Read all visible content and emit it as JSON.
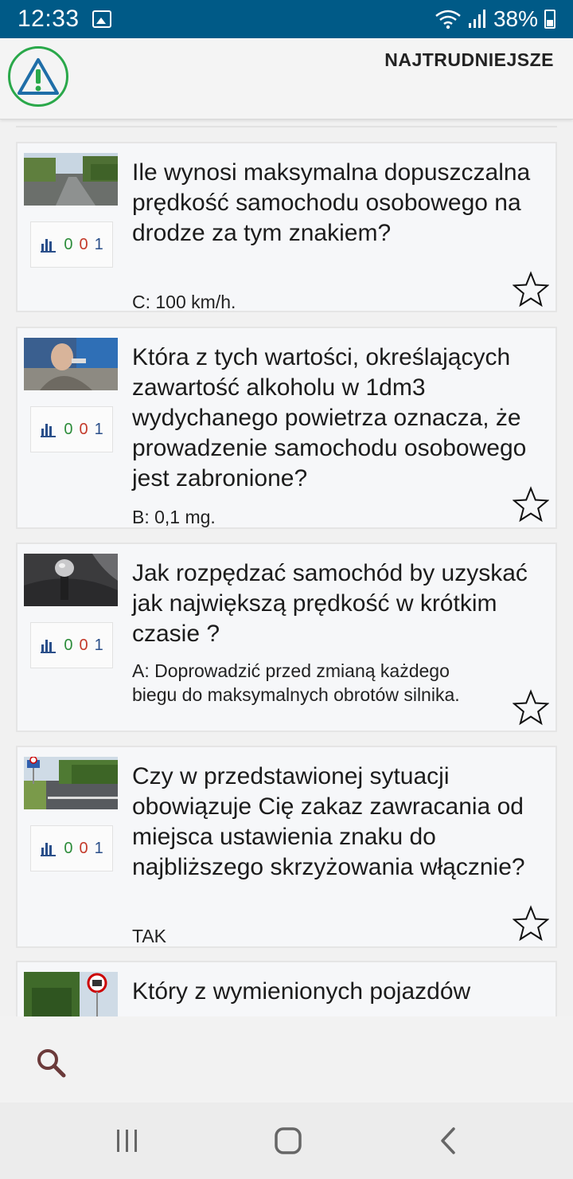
{
  "status": {
    "time": "12:33",
    "battery": "38%"
  },
  "appbar": {
    "title": "NAJTRUDNIEJSZE"
  },
  "questions": [
    {
      "text": "Ile wynosi maksymalna dopuszczalna prędkość samochodu osobowego na drodze za tym znakiem?",
      "answer": "C: 100 km/h.",
      "stats": {
        "correct": "0",
        "wrong": "0",
        "total": "1"
      }
    },
    {
      "text": "Która z tych wartości, określających zawartość alkoholu w 1dm3 wydychanego powietrza oznacza, że prowadzenie samochodu osobowego jest zabronione?",
      "answer": "B: 0,1 mg.",
      "stats": {
        "correct": "0",
        "wrong": "0",
        "total": "1"
      }
    },
    {
      "text": "Jak rozpędzać samochód by uzyskać jak największą prędkość w krótkim czasie ?",
      "answer": "A: Doprowadzić przed zmianą każdego biegu do maksymalnych obrotów silnika.",
      "stats": {
        "correct": "0",
        "wrong": "0",
        "total": "1"
      }
    },
    {
      "text": "Czy w przedstawionej sytuacji obowiązuje Cię zakaz zawracania od miejsca ustawienia znaku do najbliższego skrzyżowania włącznie?",
      "answer": "TAK",
      "stats": {
        "correct": "0",
        "wrong": "0",
        "total": "1"
      }
    },
    {
      "text": "Który z wymienionych pojazdów"
    }
  ],
  "colors": {
    "statusbar": "#005a87",
    "correct": "#2c8c3a",
    "wrong": "#c43a2a",
    "total": "#2a4f8a",
    "logo": "#2aa84a"
  },
  "icons": {
    "logo": "warning-triangle-icon",
    "stats": "bar-chart-icon",
    "favorite": "star-outline-icon",
    "search": "search-icon"
  }
}
